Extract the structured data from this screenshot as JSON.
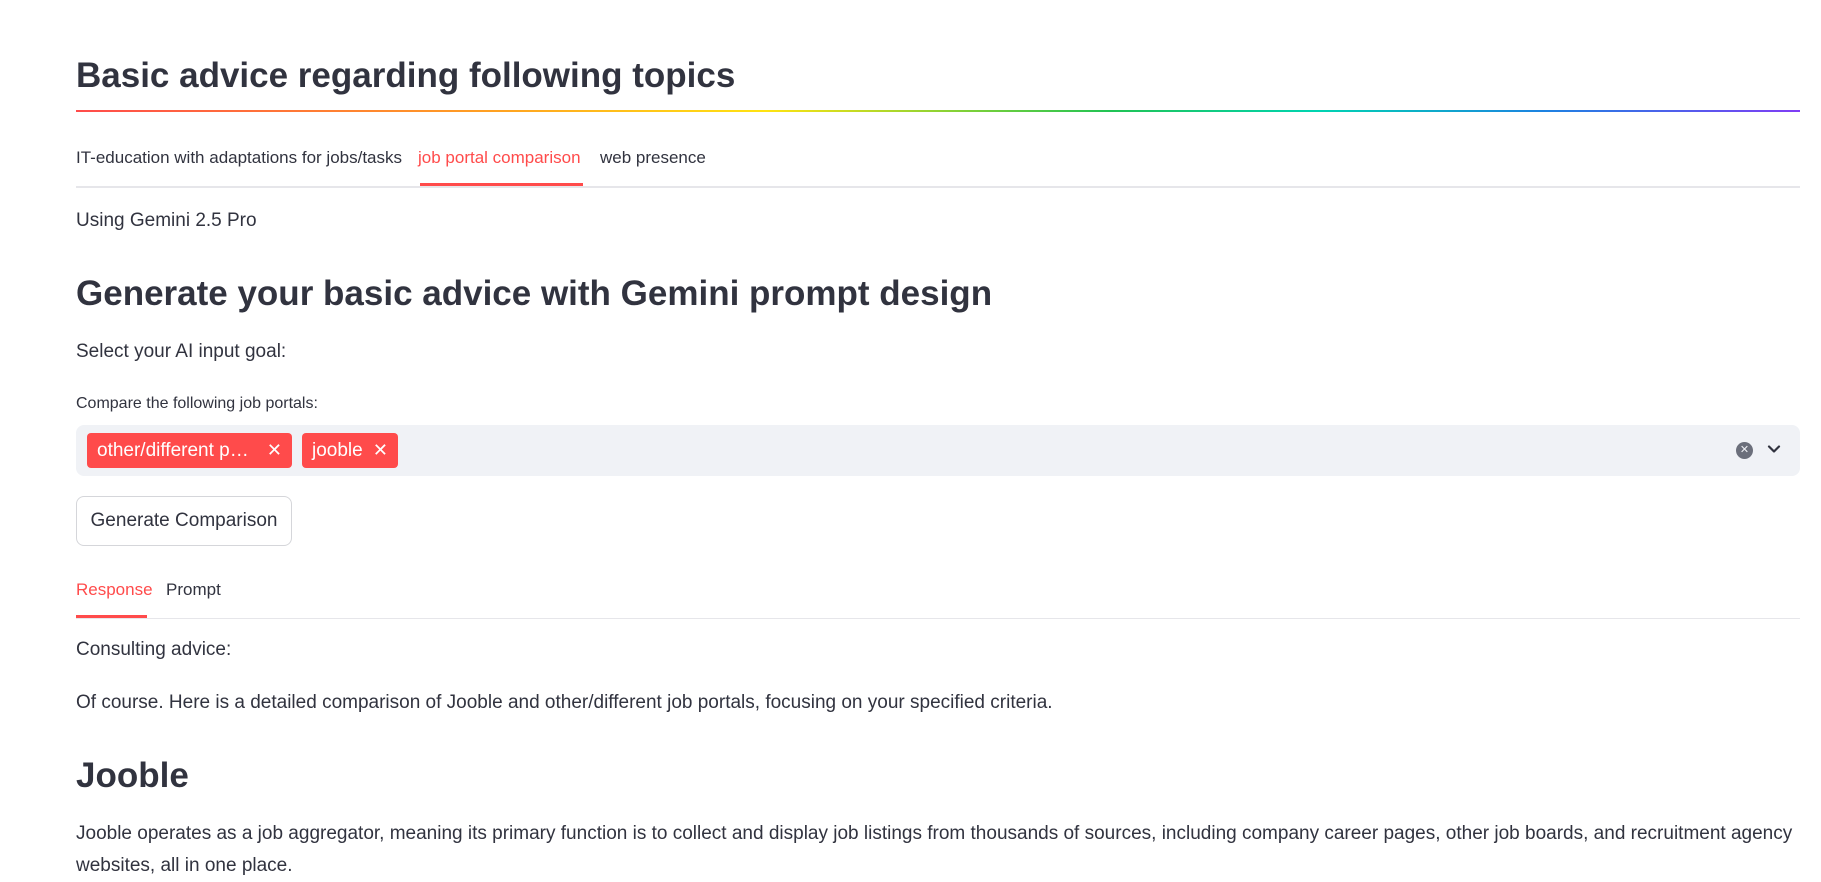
{
  "header": {
    "title": "Basic advice regarding following topics"
  },
  "topic_tabs": [
    {
      "label": "IT-education with adaptations for jobs/tasks",
      "active": false
    },
    {
      "label": "job portal comparison",
      "active": true
    },
    {
      "label": "web presence",
      "active": false
    }
  ],
  "model_info": "Using Gemini 2.5 Pro",
  "section": {
    "title": "Generate your basic advice with Gemini prompt design",
    "goal_label": "Select your AI input goal:"
  },
  "multiselect": {
    "label": "Compare the following job portals:",
    "selected": [
      "other/different p…",
      "jooble"
    ]
  },
  "generate_button": "Generate Comparison",
  "result_tabs": [
    {
      "label": "Response",
      "active": true
    },
    {
      "label": "Prompt",
      "active": false
    }
  ],
  "response": {
    "heading": "Consulting advice:",
    "intro": "Of course. Here is a detailed comparison of Jooble and other/different job portals, focusing on your specified criteria.",
    "subheading": "Jooble",
    "paragraph": "Jooble operates as a job aggregator, meaning its primary function is to collect and display job listings from thousands of sources, including company career pages, other job boards, and recruitment agency websites, all in one place."
  },
  "colors": {
    "accent": "#ff4b4b",
    "text": "#31333f",
    "input_bg": "#f0f2f6"
  }
}
